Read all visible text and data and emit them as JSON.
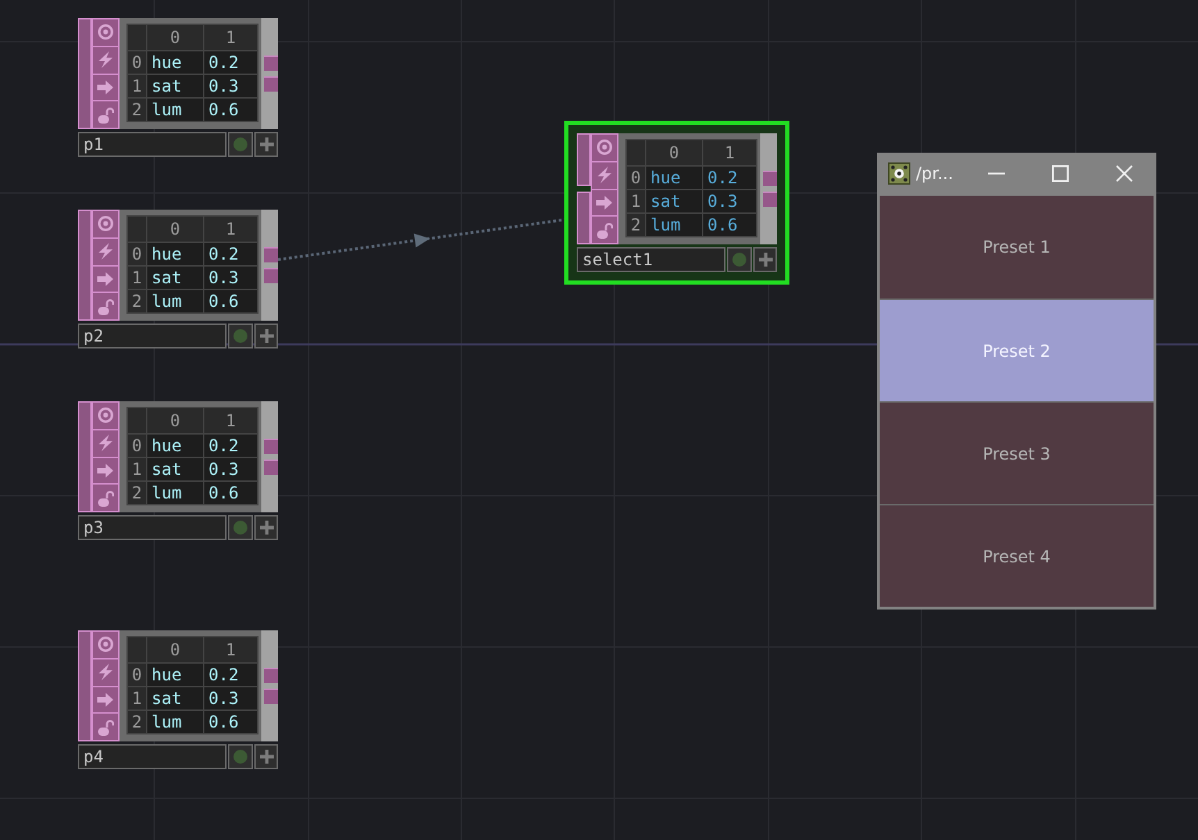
{
  "nodes": [
    {
      "kind": "source",
      "name": "p1",
      "selected": false,
      "linked": false,
      "table": {
        "columns": [
          "0",
          "1"
        ],
        "rows": [
          {
            "index": "0",
            "cells": [
              "hue",
              "0.2"
            ]
          },
          {
            "index": "1",
            "cells": [
              "sat",
              "0.3"
            ]
          },
          {
            "index": "2",
            "cells": [
              "lum",
              "0.6"
            ]
          }
        ]
      }
    },
    {
      "kind": "source",
      "name": "p2",
      "selected": false,
      "linked": true,
      "table": {
        "columns": [
          "0",
          "1"
        ],
        "rows": [
          {
            "index": "0",
            "cells": [
              "hue",
              "0.2"
            ]
          },
          {
            "index": "1",
            "cells": [
              "sat",
              "0.3"
            ]
          },
          {
            "index": "2",
            "cells": [
              "lum",
              "0.6"
            ]
          }
        ]
      }
    },
    {
      "kind": "source",
      "name": "p3",
      "selected": false,
      "linked": false,
      "table": {
        "columns": [
          "0",
          "1"
        ],
        "rows": [
          {
            "index": "0",
            "cells": [
              "hue",
              "0.2"
            ]
          },
          {
            "index": "1",
            "cells": [
              "sat",
              "0.3"
            ]
          },
          {
            "index": "2",
            "cells": [
              "lum",
              "0.6"
            ]
          }
        ]
      }
    },
    {
      "kind": "source",
      "name": "p4",
      "selected": false,
      "linked": false,
      "table": {
        "columns": [
          "0",
          "1"
        ],
        "rows": [
          {
            "index": "0",
            "cells": [
              "hue",
              "0.2"
            ]
          },
          {
            "index": "1",
            "cells": [
              "sat",
              "0.3"
            ]
          },
          {
            "index": "2",
            "cells": [
              "lum",
              "0.6"
            ]
          }
        ]
      }
    },
    {
      "kind": "select",
      "name": "select1",
      "selected": true,
      "linked": false,
      "table": {
        "columns": [
          "0",
          "1"
        ],
        "rows": [
          {
            "index": "0",
            "cells": [
              "hue",
              "0.2"
            ]
          },
          {
            "index": "1",
            "cells": [
              "sat",
              "0.3"
            ]
          },
          {
            "index": "2",
            "cells": [
              "lum",
              "0.6"
            ]
          }
        ]
      }
    }
  ],
  "window": {
    "title": "/pr...",
    "presets": [
      {
        "label": "Preset 1",
        "selected": false
      },
      {
        "label": "Preset 2",
        "selected": true
      },
      {
        "label": "Preset 3",
        "selected": false
      },
      {
        "label": "Preset 4",
        "selected": false
      }
    ]
  }
}
